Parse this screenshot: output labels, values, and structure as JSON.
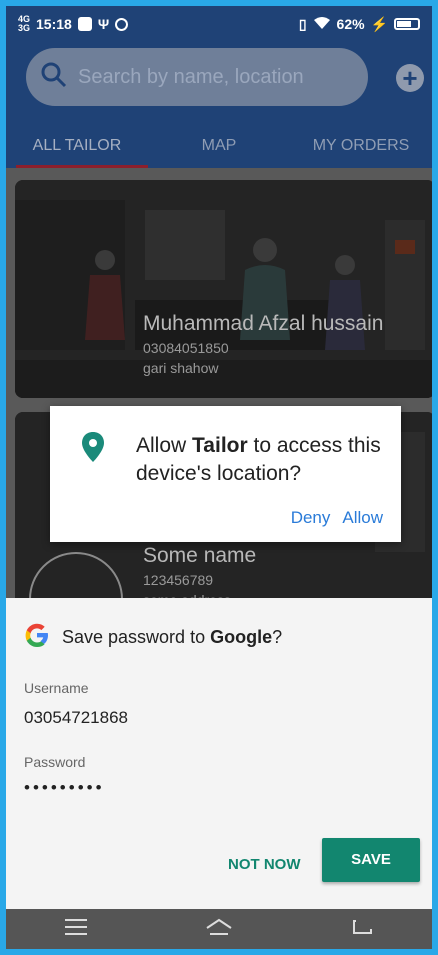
{
  "status_bar": {
    "network": [
      "4G",
      "3G"
    ],
    "time": "15:18",
    "battery": "62%"
  },
  "search": {
    "placeholder": "Search by name, location"
  },
  "tabs": [
    {
      "label": "ALL TAILOR",
      "active": true
    },
    {
      "label": "MAP",
      "active": false
    },
    {
      "label": "MY ORDERS",
      "active": false
    }
  ],
  "cards": [
    {
      "name": "Muhammad Afzal hussain",
      "phone": "03084051850",
      "address": "gari shahow"
    },
    {
      "name": "Some name",
      "phone": "123456789",
      "address": "some address"
    }
  ],
  "location_dialog": {
    "prefix": "Allow ",
    "app": "Tailor",
    "suffix": " to access this device's location?",
    "deny": "Deny",
    "allow": "Allow",
    "accent": "#1a8a7a"
  },
  "save_password": {
    "prefix": "Save password to ",
    "provider": "Google",
    "suffix": "?",
    "username_label": "Username",
    "username": "03054721868",
    "password_label": "Password",
    "password_mask": "•••••••••",
    "not_now": "NOT NOW",
    "save": "SAVE",
    "accent": "#12866f"
  },
  "nav": [
    "menu-icon",
    "home-icon",
    "back-icon"
  ]
}
